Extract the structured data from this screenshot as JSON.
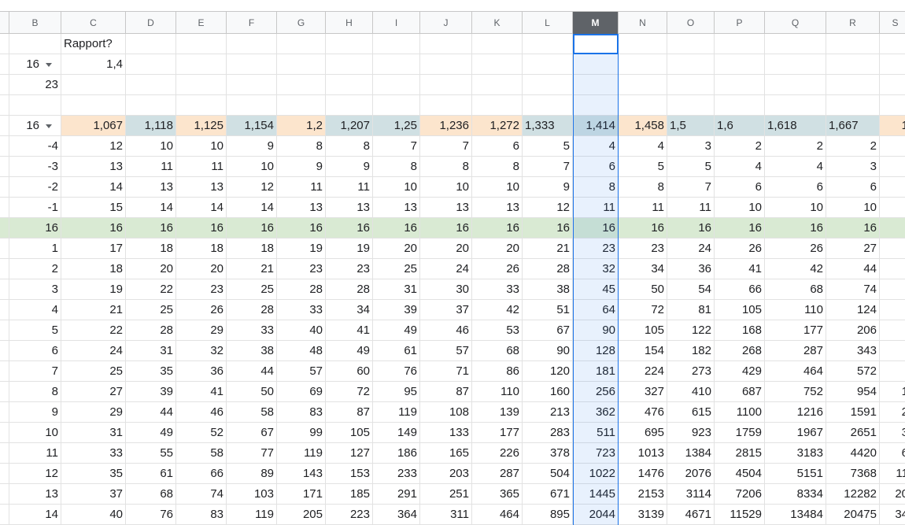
{
  "columns": [
    "B",
    "C",
    "D",
    "E",
    "F",
    "G",
    "H",
    "I",
    "J",
    "K",
    "L",
    "M",
    "N",
    "O",
    "P",
    "Q",
    "R",
    "S"
  ],
  "selected_column": "M",
  "top_rows": [
    {
      "b": "",
      "c": "Rapport?",
      "dropdown": false
    },
    {
      "b": "16",
      "c": "1,4",
      "dropdown": true
    },
    {
      "b": "23",
      "c": "",
      "dropdown": false
    },
    {
      "b": "",
      "c": "",
      "dropdown": false
    }
  ],
  "ratio_row": {
    "b": "16",
    "values": [
      "1,067",
      "1,118",
      "1,125",
      "1,154",
      "1,2",
      "1,207",
      "1,25",
      "1,236",
      "1,272",
      "1,333",
      "1,414",
      "1,458",
      "1,5",
      "1,6",
      "1,618",
      "1,667",
      "1"
    ],
    "colors": [
      "peach",
      "teal",
      "peach",
      "teal",
      "peach",
      "teal",
      "teal",
      "peach",
      "peach",
      "teal",
      "teal",
      "peach",
      "teal",
      "teal",
      "teal",
      "teal",
      "peach"
    ]
  },
  "data_rows": [
    {
      "b": "-4",
      "values": [
        "12",
        "10",
        "10",
        "9",
        "8",
        "8",
        "7",
        "7",
        "6",
        "5",
        "4",
        "4",
        "3",
        "2",
        "2",
        "2",
        ""
      ]
    },
    {
      "b": "-3",
      "values": [
        "13",
        "11",
        "11",
        "10",
        "9",
        "9",
        "8",
        "8",
        "8",
        "7",
        "6",
        "5",
        "5",
        "4",
        "4",
        "3",
        ""
      ]
    },
    {
      "b": "-2",
      "values": [
        "14",
        "13",
        "13",
        "12",
        "11",
        "11",
        "10",
        "10",
        "10",
        "9",
        "8",
        "8",
        "7",
        "6",
        "6",
        "6",
        ""
      ]
    },
    {
      "b": "-1",
      "values": [
        "15",
        "14",
        "14",
        "14",
        "13",
        "13",
        "13",
        "13",
        "13",
        "12",
        "11",
        "11",
        "11",
        "10",
        "10",
        "10",
        ""
      ]
    },
    {
      "b": "16",
      "values": [
        "16",
        "16",
        "16",
        "16",
        "16",
        "16",
        "16",
        "16",
        "16",
        "16",
        "16",
        "16",
        "16",
        "16",
        "16",
        "16",
        ""
      ],
      "highlight": true
    },
    {
      "b": "1",
      "values": [
        "17",
        "18",
        "18",
        "18",
        "19",
        "19",
        "20",
        "20",
        "20",
        "21",
        "23",
        "23",
        "24",
        "26",
        "26",
        "27",
        ""
      ]
    },
    {
      "b": "2",
      "values": [
        "18",
        "20",
        "20",
        "21",
        "23",
        "23",
        "25",
        "24",
        "26",
        "28",
        "32",
        "34",
        "36",
        "41",
        "42",
        "44",
        ""
      ]
    },
    {
      "b": "3",
      "values": [
        "19",
        "22",
        "23",
        "25",
        "28",
        "28",
        "31",
        "30",
        "33",
        "38",
        "45",
        "50",
        "54",
        "66",
        "68",
        "74",
        ""
      ]
    },
    {
      "b": "4",
      "values": [
        "21",
        "25",
        "26",
        "28",
        "33",
        "34",
        "39",
        "37",
        "42",
        "51",
        "64",
        "72",
        "81",
        "105",
        "110",
        "124",
        ""
      ]
    },
    {
      "b": "5",
      "values": [
        "22",
        "28",
        "29",
        "33",
        "40",
        "41",
        "49",
        "46",
        "53",
        "67",
        "90",
        "105",
        "122",
        "168",
        "177",
        "206",
        ""
      ]
    },
    {
      "b": "6",
      "values": [
        "24",
        "31",
        "32",
        "38",
        "48",
        "49",
        "61",
        "57",
        "68",
        "90",
        "128",
        "154",
        "182",
        "268",
        "287",
        "343",
        ""
      ]
    },
    {
      "b": "7",
      "values": [
        "25",
        "35",
        "36",
        "44",
        "57",
        "60",
        "76",
        "71",
        "86",
        "120",
        "181",
        "224",
        "273",
        "429",
        "464",
        "572",
        ""
      ]
    },
    {
      "b": "8",
      "values": [
        "27",
        "39",
        "41",
        "50",
        "69",
        "72",
        "95",
        "87",
        "110",
        "160",
        "256",
        "327",
        "410",
        "687",
        "752",
        "954",
        "1"
      ]
    },
    {
      "b": "9",
      "values": [
        "29",
        "44",
        "46",
        "58",
        "83",
        "87",
        "119",
        "108",
        "139",
        "213",
        "362",
        "476",
        "615",
        "1100",
        "1216",
        "1591",
        "2"
      ]
    },
    {
      "b": "10",
      "values": [
        "31",
        "49",
        "52",
        "67",
        "99",
        "105",
        "149",
        "133",
        "177",
        "283",
        "511",
        "695",
        "923",
        "1759",
        "1967",
        "2651",
        "3"
      ]
    },
    {
      "b": "11",
      "values": [
        "33",
        "55",
        "58",
        "77",
        "119",
        "127",
        "186",
        "165",
        "226",
        "378",
        "723",
        "1013",
        "1384",
        "2815",
        "3183",
        "4420",
        "6"
      ]
    },
    {
      "b": "12",
      "values": [
        "35",
        "61",
        "66",
        "89",
        "143",
        "153",
        "233",
        "203",
        "287",
        "504",
        "1022",
        "1476",
        "2076",
        "4504",
        "5151",
        "7368",
        "11"
      ]
    },
    {
      "b": "13",
      "values": [
        "37",
        "68",
        "74",
        "103",
        "171",
        "185",
        "291",
        "251",
        "365",
        "671",
        "1445",
        "2153",
        "3114",
        "7206",
        "8334",
        "12282",
        "20"
      ]
    },
    {
      "b": "14",
      "values": [
        "40",
        "76",
        "83",
        "119",
        "205",
        "223",
        "364",
        "311",
        "464",
        "895",
        "2044",
        "3139",
        "4671",
        "11529",
        "13484",
        "20475",
        "34"
      ]
    }
  ],
  "colors": {
    "selection": "#1a73e8",
    "highlight_row": "#d9ead3",
    "peach": "#fce5cd",
    "teal": "#d0e0e3"
  }
}
